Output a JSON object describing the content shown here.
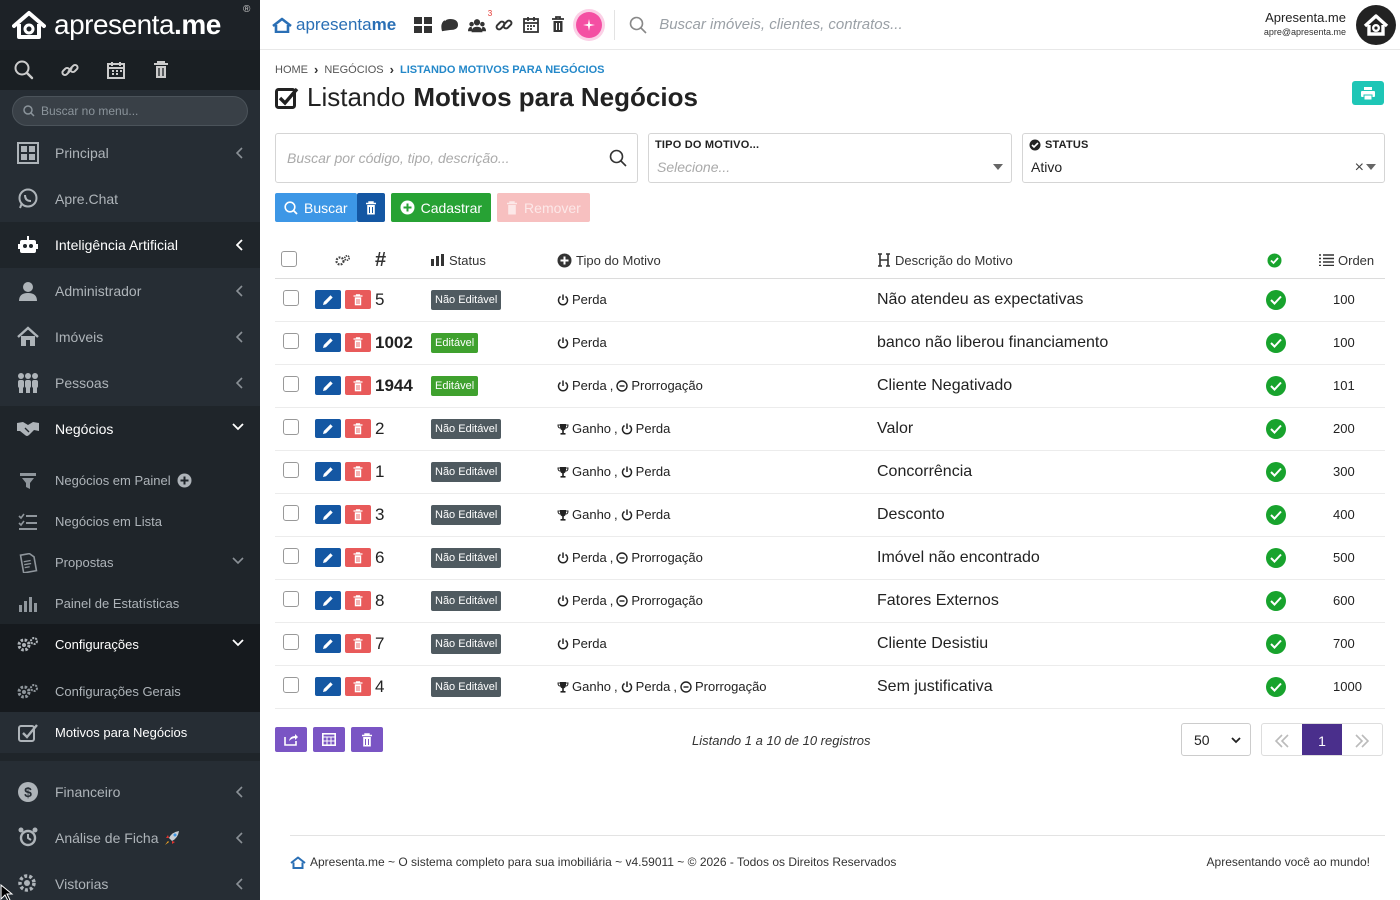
{
  "brand": {
    "name_light": "apresenta",
    "name_bold": ".me",
    "reg_mark": "®"
  },
  "sidebar": {
    "search_placeholder": "Buscar no menu...",
    "items": [
      {
        "label": "Principal"
      },
      {
        "label": "Apre.Chat"
      },
      {
        "label": "Inteligência Artificial"
      },
      {
        "label": "Administrador"
      },
      {
        "label": "Imóveis"
      },
      {
        "label": "Pessoas"
      },
      {
        "label": "Negócios"
      }
    ],
    "negocios_sub": [
      {
        "label": "Negócios em Painel"
      },
      {
        "label": "Negócios em Lista"
      },
      {
        "label": "Propostas"
      },
      {
        "label": "Painel de Estatísticas"
      },
      {
        "label": "Configurações"
      }
    ],
    "config_sub": [
      {
        "label": "Configurações Gerais"
      },
      {
        "label": "Motivos para Negócios"
      }
    ],
    "bottom_items": [
      {
        "label": "Financeiro"
      },
      {
        "label": "Análise de Ficha"
      },
      {
        "label": "Vistorias"
      }
    ]
  },
  "header": {
    "logo_light": "apresenta",
    "logo_bold": "me",
    "badge_count": "3",
    "search_placeholder": "Buscar imóveis, clientes, contratos...",
    "user_name": "Apresenta.me",
    "user_email": "apre@apresenta.me"
  },
  "breadcrumb": {
    "home": "HOME",
    "section": "NEGÓCIOS",
    "current": "LISTANDO MOTIVOS PARA NEGÓCIOS"
  },
  "page": {
    "title_light": "Listando",
    "title_bold": "Motivos para Negócios"
  },
  "filters": {
    "search_placeholder": "Buscar por código, tipo, descrição...",
    "tipo_label": "TIPO DO MOTIVO...",
    "tipo_placeholder": "Selecione...",
    "status_label": "STATUS",
    "status_value": "Ativo"
  },
  "actions": {
    "search": "Buscar",
    "create": "Cadastrar",
    "remove": "Remover"
  },
  "table": {
    "headers": {
      "id": "#",
      "status": "Status",
      "tipo": "Tipo do Motivo",
      "descricao": "Descrição do Motivo",
      "ordem": "Orden"
    },
    "rows": [
      {
        "id": "5",
        "bold": false,
        "status": "Não Editável",
        "editable": false,
        "tipos": [
          {
            "icon": "power",
            "label": "Perda"
          }
        ],
        "descricao": "Não atendeu as expectativas",
        "ordem": "100"
      },
      {
        "id": "1002",
        "bold": true,
        "status": "Editável",
        "editable": true,
        "tipos": [
          {
            "icon": "power",
            "label": "Perda"
          }
        ],
        "descricao": "banco não liberou financiamento",
        "ordem": "100"
      },
      {
        "id": "1944",
        "bold": true,
        "status": "Editável",
        "editable": true,
        "tipos": [
          {
            "icon": "power",
            "label": "Perda"
          },
          {
            "icon": "clock",
            "label": "Prorrogação"
          }
        ],
        "descricao": "Cliente Negativado",
        "ordem": "101"
      },
      {
        "id": "2",
        "bold": false,
        "status": "Não Editável",
        "editable": false,
        "tipos": [
          {
            "icon": "trophy",
            "label": "Ganho"
          },
          {
            "icon": "power",
            "label": "Perda"
          }
        ],
        "descricao": "Valor",
        "ordem": "200"
      },
      {
        "id": "1",
        "bold": false,
        "status": "Não Editável",
        "editable": false,
        "tipos": [
          {
            "icon": "trophy",
            "label": "Ganho"
          },
          {
            "icon": "power",
            "label": "Perda"
          }
        ],
        "descricao": "Concorrência",
        "ordem": "300"
      },
      {
        "id": "3",
        "bold": false,
        "status": "Não Editável",
        "editable": false,
        "tipos": [
          {
            "icon": "trophy",
            "label": "Ganho"
          },
          {
            "icon": "power",
            "label": "Perda"
          }
        ],
        "descricao": "Desconto",
        "ordem": "400"
      },
      {
        "id": "6",
        "bold": false,
        "status": "Não Editável",
        "editable": false,
        "tipos": [
          {
            "icon": "power",
            "label": "Perda"
          },
          {
            "icon": "clock",
            "label": "Prorrogação"
          }
        ],
        "descricao": "Imóvel não encontrado",
        "ordem": "500"
      },
      {
        "id": "8",
        "bold": false,
        "status": "Não Editável",
        "editable": false,
        "tipos": [
          {
            "icon": "power",
            "label": "Perda"
          },
          {
            "icon": "clock",
            "label": "Prorrogação"
          }
        ],
        "descricao": "Fatores Externos",
        "ordem": "600"
      },
      {
        "id": "7",
        "bold": false,
        "status": "Não Editável",
        "editable": false,
        "tipos": [
          {
            "icon": "power",
            "label": "Perda"
          }
        ],
        "descricao": "Cliente Desistiu",
        "ordem": "700"
      },
      {
        "id": "4",
        "bold": false,
        "status": "Não Editável",
        "editable": false,
        "tipos": [
          {
            "icon": "trophy",
            "label": "Ganho"
          },
          {
            "icon": "power",
            "label": "Perda"
          },
          {
            "icon": "clock",
            "label": "Prorrogação"
          }
        ],
        "descricao": "Sem justificativa",
        "ordem": "1000"
      }
    ]
  },
  "pagination": {
    "listing_text": "Listando 1 a 10 de 10 registros",
    "per_page": "50",
    "current_page": "1"
  },
  "footer": {
    "left": "Apresenta.me ~ O sistema completo para sua imobiliária ~ v4.59011 ~ © 2026 - Todos os Direitos Reservados",
    "right": "Apresentando você ao mundo!"
  },
  "colors": {
    "sidebar_bg": "#262d34",
    "brand_blue": "#2a6fb5",
    "accent_teal": "#1ec6b6",
    "success": "#18a32d",
    "danger": "#e85a5a",
    "purple": "#7a55c4"
  }
}
